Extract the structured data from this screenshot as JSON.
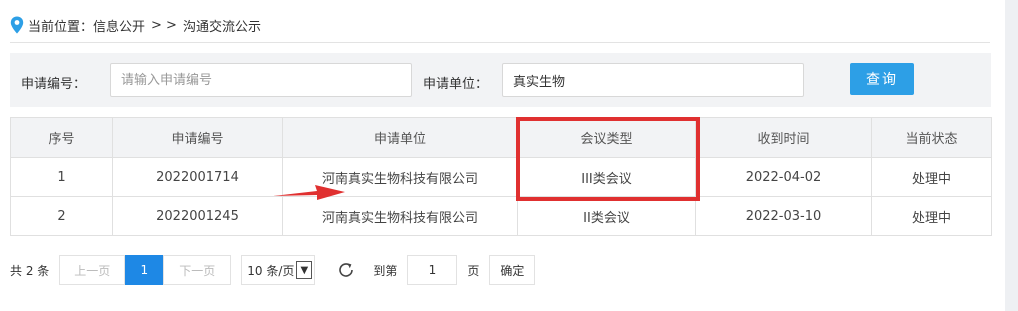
{
  "breadcrumb": {
    "prefix": "当前位置：",
    "level1": "信息公开",
    "sep": "> >",
    "level2": "沟通交流公示"
  },
  "search": {
    "application_no_label": "申请编号：",
    "application_no_placeholder": "请输入申请编号",
    "applicant_label": "申请单位：",
    "applicant_value": "真实生物",
    "query_label": "查询"
  },
  "table": {
    "headers": [
      "序号",
      "申请编号",
      "申请单位",
      "会议类型",
      "收到时间",
      "当前状态"
    ],
    "rows": [
      [
        "1",
        "2022001714",
        "河南真实生物科技有限公司",
        "III类会议",
        "2022-04-02",
        "处理中"
      ],
      [
        "2",
        "2022001245",
        "河南真实生物科技有限公司",
        "II类会议",
        "2022-03-10",
        "处理中"
      ]
    ]
  },
  "pagination": {
    "total": "共 2 条",
    "prev": "上一页",
    "current": "1",
    "next": "下一页",
    "page_size": "10 条/页",
    "goto_label": "到第",
    "goto_value": "1",
    "page_unit": "页",
    "confirm": "确定"
  },
  "colors": {
    "accent": "#1e88e5",
    "query_button": "#2d9fe6",
    "annotation": "#e03030"
  },
  "icons": [
    "location-pin-icon",
    "refresh-icon",
    "dropdown-arrow-icon",
    "annotation-arrow-icon"
  ]
}
